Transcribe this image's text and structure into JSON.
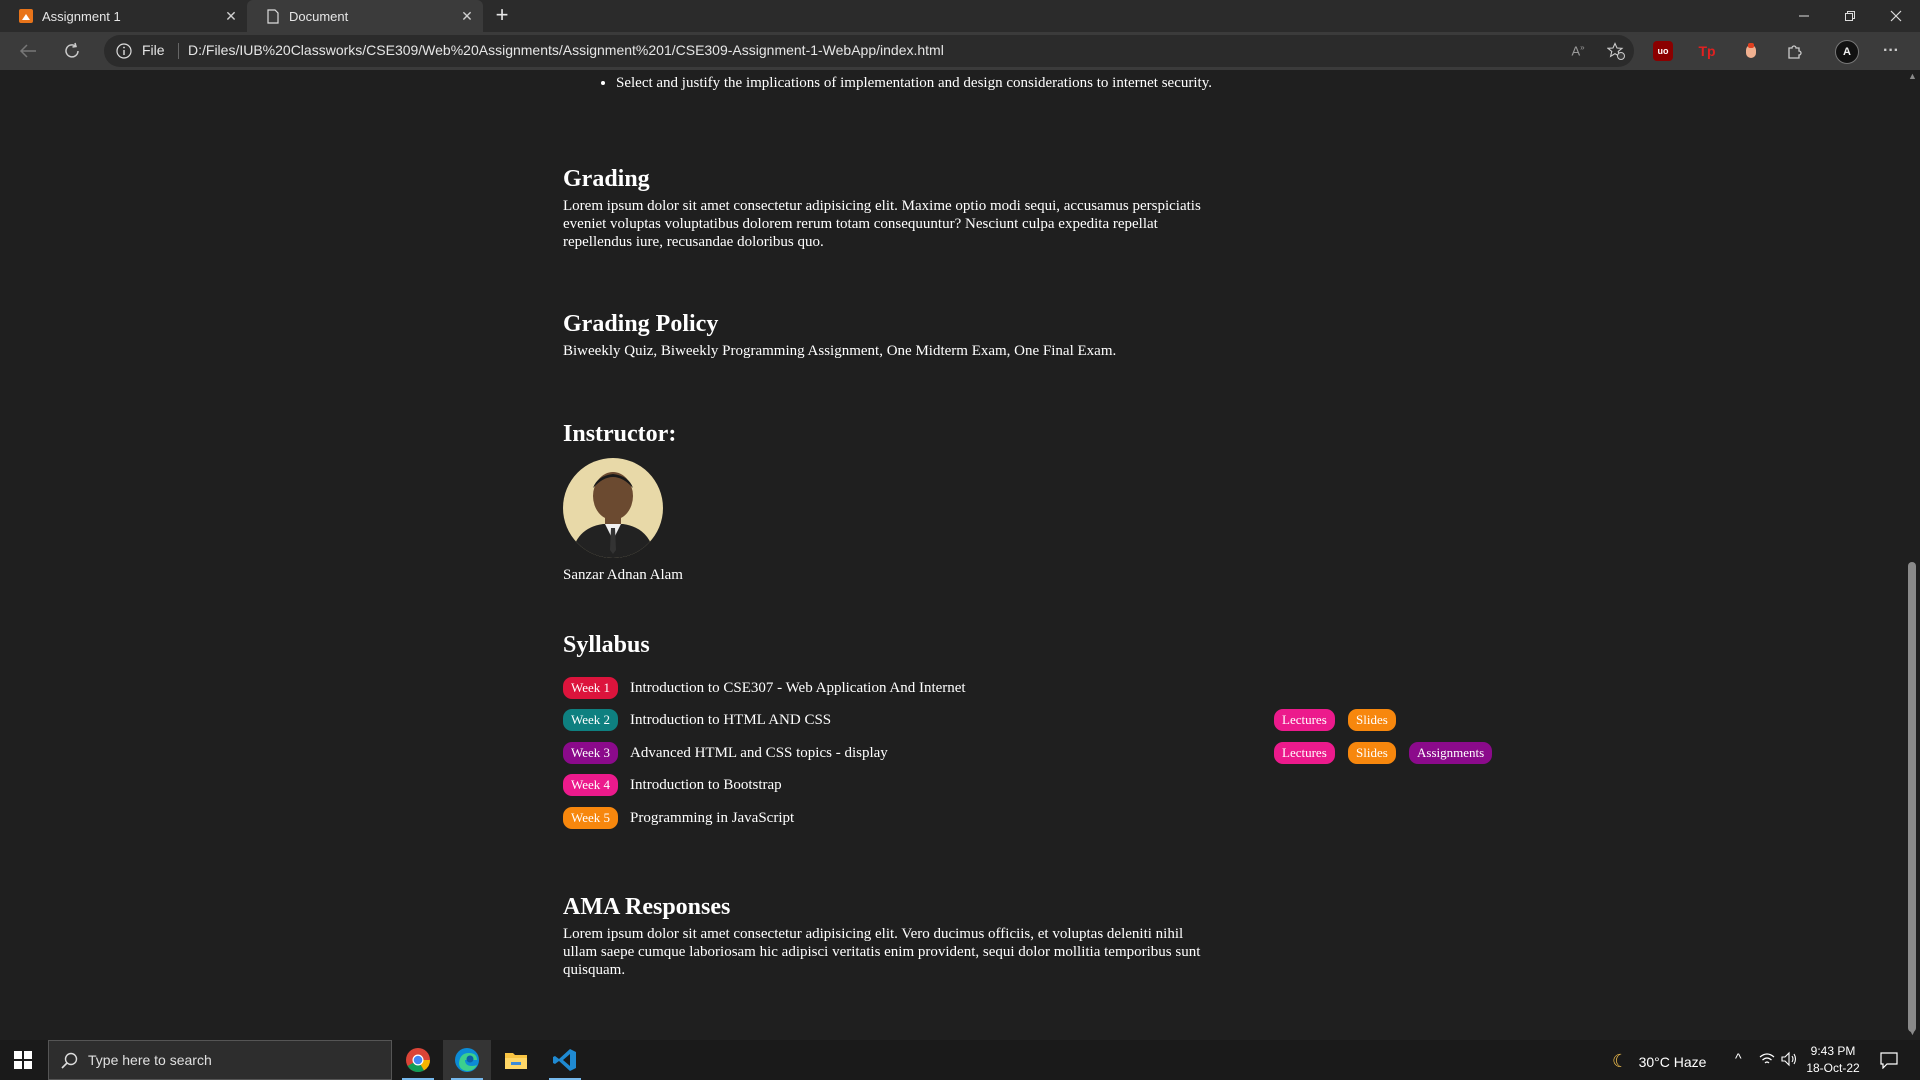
{
  "browser": {
    "tabs": [
      {
        "title": "Assignment 1",
        "active": false,
        "icon": "orange-page-icon"
      },
      {
        "title": "Document",
        "active": true,
        "icon": "document-icon"
      }
    ],
    "address": {
      "scheme_label": "File",
      "url": "D:/Files/IUB%20Classworks/CSE309/Web%20Assignments/Assignment%201/CSE309-Assignment-1-WebApp/index.html"
    },
    "extensions": {
      "ublock_label": "uo",
      "tp_label": "Tp",
      "profile_initial": "A"
    }
  },
  "page": {
    "objective_item": "Select and justify the implications of implementation and design considerations to internet security.",
    "grading": {
      "heading": "Grading",
      "text": "Lorem ipsum dolor sit amet consectetur adipisicing elit. Maxime optio modi sequi, accusamus perspiciatis eveniet voluptas voluptatibus dolorem rerum totam consequuntur? Nesciunt culpa expedita repellat repellendus iure, recusandae doloribus quo."
    },
    "grading_policy": {
      "heading": "Grading Policy",
      "text": "Biweekly Quiz, Biweekly Programming Assignment, One Midterm Exam, One Final Exam."
    },
    "instructor": {
      "heading": "Instructor:",
      "name": "Sanzar Adnan Alam"
    },
    "syllabus": {
      "heading": "Syllabus",
      "weeks": [
        {
          "badge": "Week 1",
          "title": "Introduction to CSE307 - Web Application And Internet",
          "color": "#dc143c"
        },
        {
          "badge": "Week 2",
          "title": "Introduction to HTML AND CSS",
          "color": "#0e8080"
        },
        {
          "badge": "Week 3",
          "title": "Advanced HTML and CSS topics - display",
          "color": "#8b0a8b"
        },
        {
          "badge": "Week 4",
          "title": "Introduction to Bootstrap",
          "color": "#ec1a8c"
        },
        {
          "badge": "Week 5",
          "title": "Programming in JavaScript",
          "color": "#f7870d"
        }
      ],
      "resource_labels": {
        "lectures": "Lectures",
        "slides": "Slides",
        "assignments": "Assignments"
      },
      "resource_colors": {
        "lectures": "#ec1a8c",
        "slides": "#f7870d",
        "assignments": "#8b0a8b"
      }
    },
    "ama": {
      "heading": "AMA Responses",
      "text": "Lorem ipsum dolor sit amet consectetur adipisicing elit. Vero ducimus officiis, et voluptas deleniti nihil ullam saepe cumque laboriosam hic adipisci veritatis enim provident, sequi dolor mollitia temporibus sunt quisquam."
    }
  },
  "taskbar": {
    "search_placeholder": "Type here to search",
    "weather": "30°C  Haze",
    "time": "9:43 PM",
    "date": "18-Oct-22"
  }
}
